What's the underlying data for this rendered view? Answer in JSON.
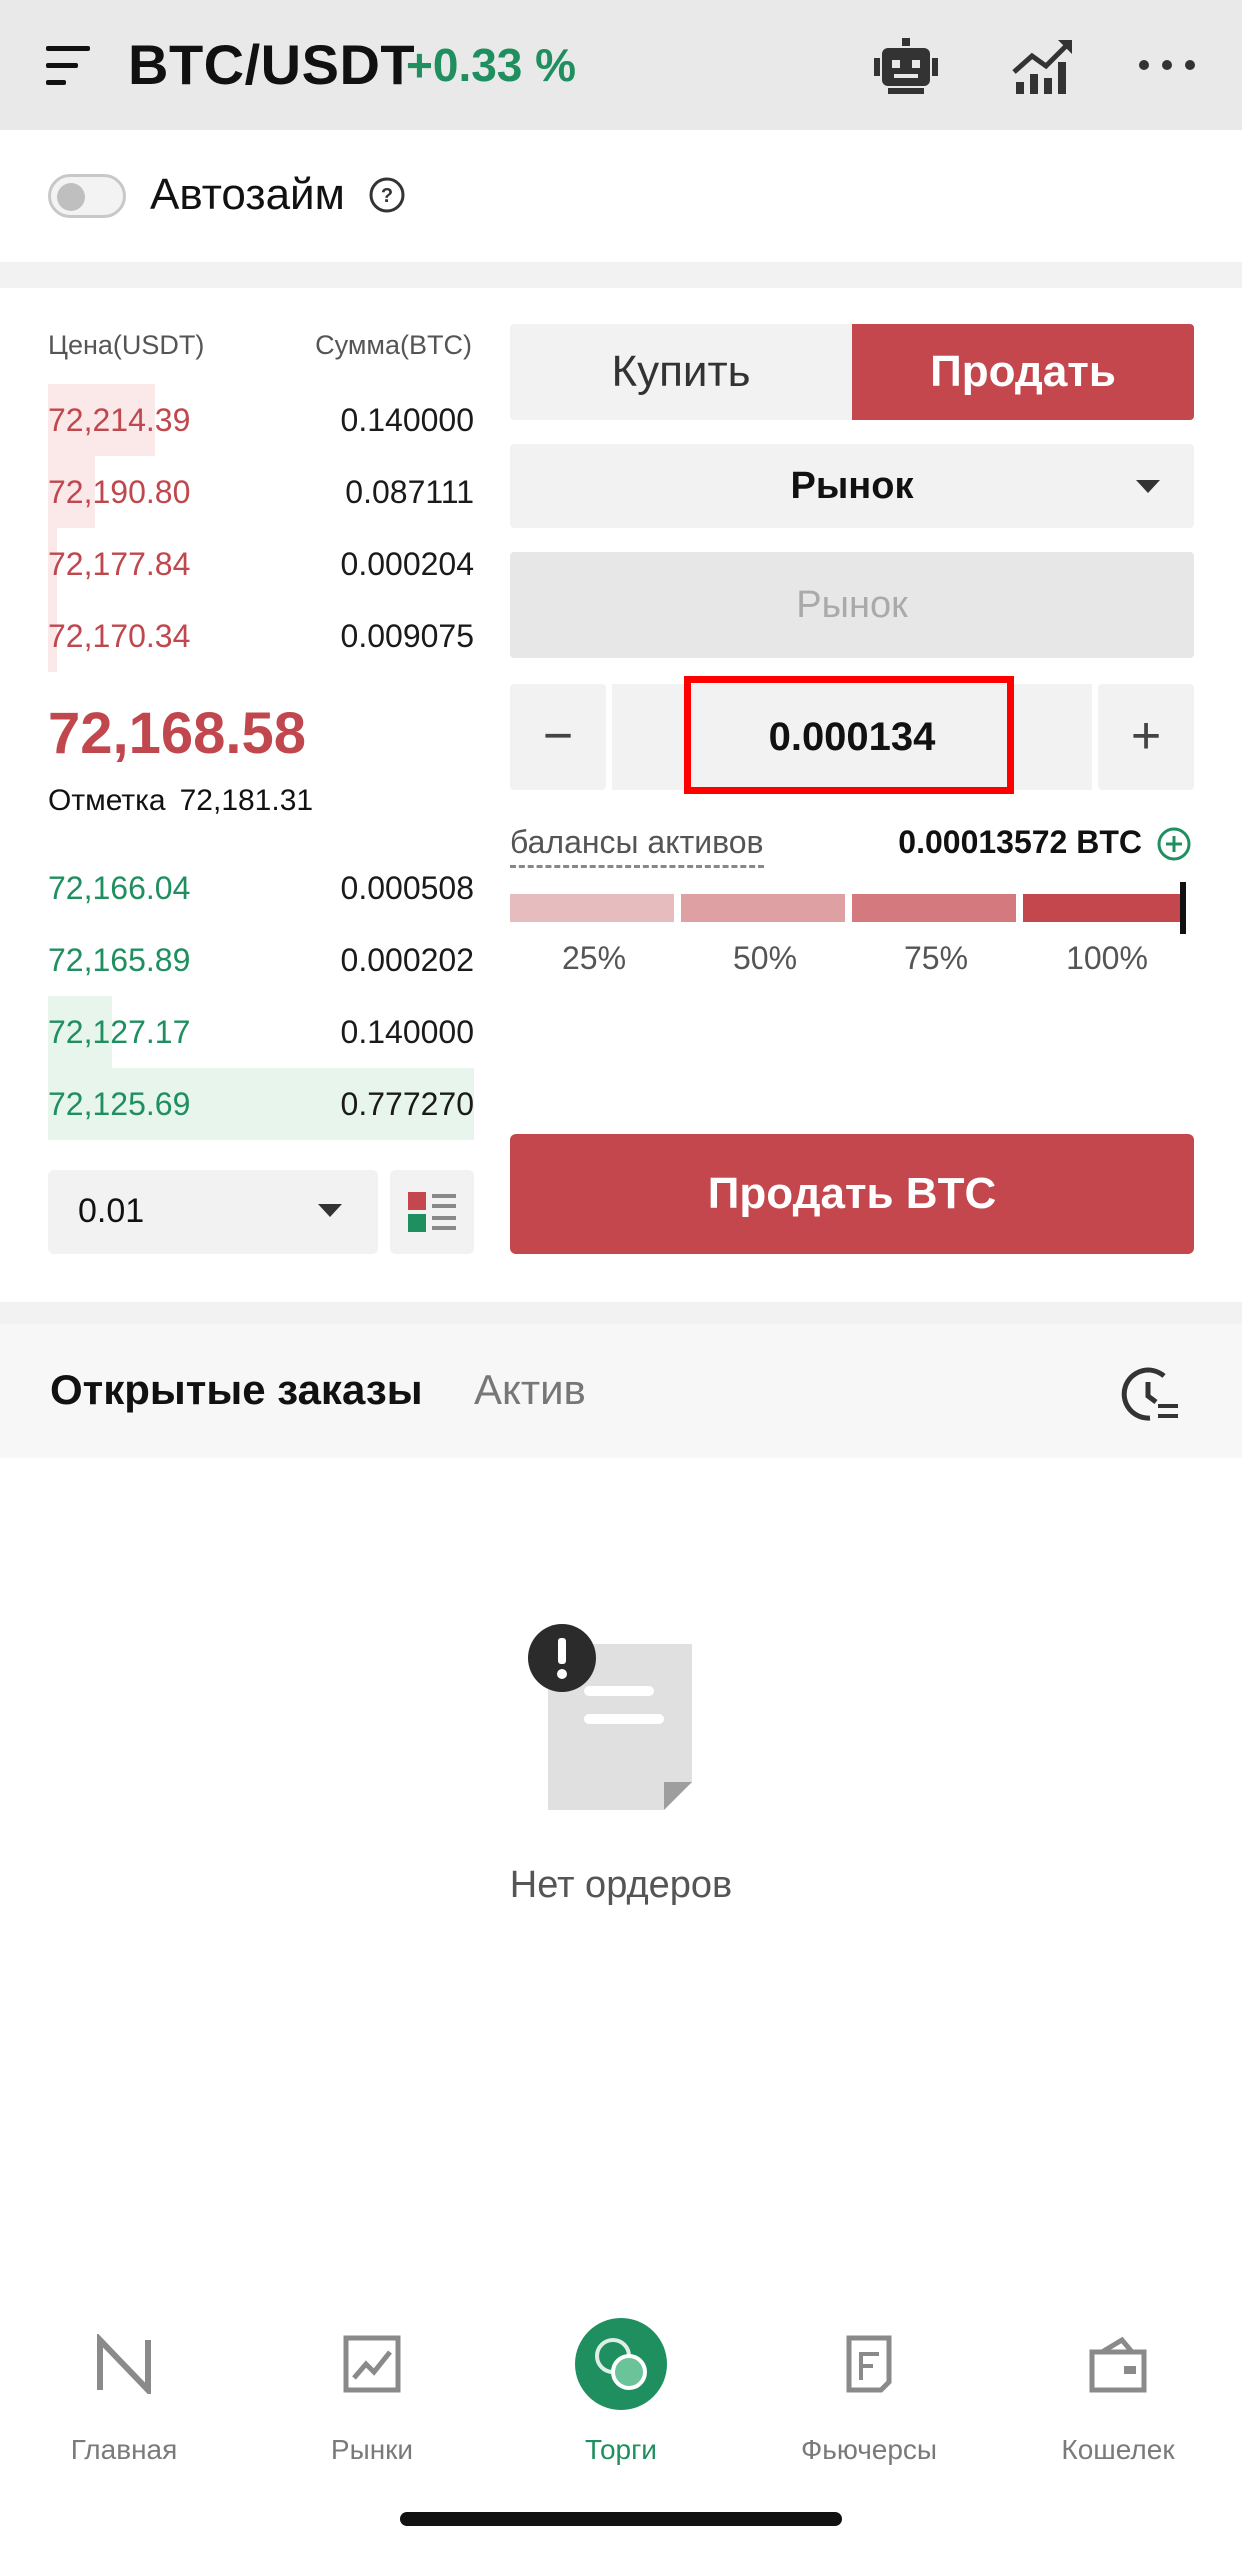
{
  "header": {
    "pair": "BTC/USDT",
    "change": "+0.33 %"
  },
  "autoloan": {
    "label": "Автозайм",
    "enabled": false
  },
  "orderbook": {
    "price_header": "Цена(USDT)",
    "amount_header": "Сумма(BTC)",
    "asks": [
      {
        "price": "72,214.39",
        "amount": "0.140000",
        "depth": 0.25
      },
      {
        "price": "72,190.80",
        "amount": "0.087111",
        "depth": 0.11
      },
      {
        "price": "72,177.84",
        "amount": "0.000204",
        "depth": 0.02
      },
      {
        "price": "72,170.34",
        "amount": "0.009075",
        "depth": 0.02
      }
    ],
    "last_price": "72,168.58",
    "mark_label": "Отметка",
    "mark_price": "72,181.31",
    "bids": [
      {
        "price": "72,166.04",
        "amount": "0.000508",
        "depth": 0.0
      },
      {
        "price": "72,165.89",
        "amount": "0.000202",
        "depth": 0.0
      },
      {
        "price": "72,127.17",
        "amount": "0.140000",
        "depth": 0.15
      },
      {
        "price": "72,125.69",
        "amount": "0.777270",
        "depth": 1.0
      }
    ],
    "precision": "0.01"
  },
  "trade": {
    "buy_label": "Купить",
    "sell_label": "Продать",
    "order_type": "Рынок",
    "price_placeholder": "Рынок",
    "amount": "0.000134",
    "minus": "−",
    "plus": "+",
    "balance_label": "балансы активов",
    "balance_value": "0.00013572 BTC",
    "percents": [
      "25%",
      "50%",
      "75%",
      "100%"
    ],
    "submit_label": "Продать BTC"
  },
  "orders": {
    "tab_open": "Открытые заказы",
    "tab_asset": "Актив",
    "empty_text": "Нет ордеров"
  },
  "nav": {
    "items": [
      {
        "label": "Главная",
        "icon": "home-icon"
      },
      {
        "label": "Рынки",
        "icon": "markets-icon"
      },
      {
        "label": "Торги",
        "icon": "trade-icon"
      },
      {
        "label": "Фьючерсы",
        "icon": "futures-icon"
      },
      {
        "label": "Кошелек",
        "icon": "wallet-icon"
      }
    ],
    "active": "Торги"
  },
  "colors": {
    "sell": "#c4474d",
    "buy": "#1f8f5f",
    "ask_bar": "#fbe9ea",
    "bid_bar": "#e7f5ec"
  }
}
